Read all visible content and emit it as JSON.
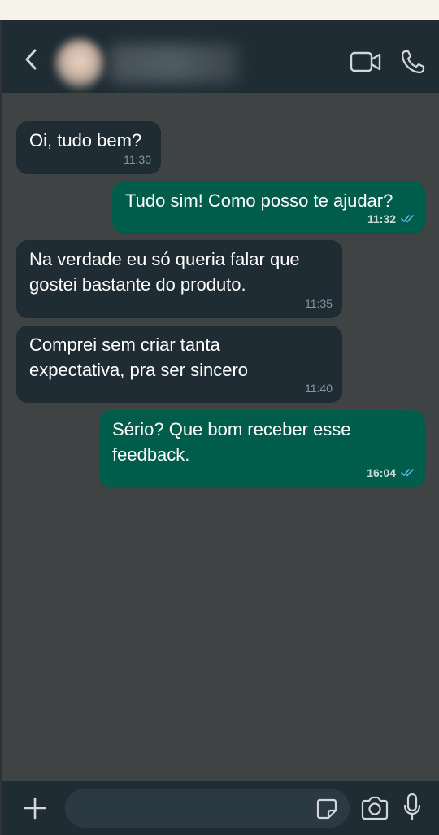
{
  "header": {
    "back_icon": "chevron-left-icon",
    "video_icon": "video-camera-icon",
    "call_icon": "phone-icon"
  },
  "messages": [
    {
      "direction": "in",
      "text": "Oi, tudo bem?",
      "time": "11:30"
    },
    {
      "direction": "out",
      "text": "Tudo sim! Como posso te ajudar?",
      "time": "11:32",
      "status": "read"
    },
    {
      "direction": "in",
      "text": "Na verdade eu só queria falar que\ngostei bastante do produto.",
      "time": "11:35"
    },
    {
      "direction": "in",
      "text": "Comprei sem criar tanta\nexpectativa, pra ser sincero",
      "time": "11:40"
    },
    {
      "direction": "out",
      "text": "Sério? Que bom receber esse\nfeedback.",
      "time": "16:04",
      "status": "read"
    }
  ],
  "input_bar": {
    "placeholder": "",
    "value": "",
    "icons": [
      "plus-icon",
      "sticker-icon",
      "camera-icon",
      "microphone-icon"
    ]
  },
  "colors": {
    "header_bg": "#1f2c33",
    "chat_bg": "#3f4344",
    "incoming_bubble": "#1f2c33",
    "outgoing_bubble": "#005c4b",
    "read_ticks": "#53bdeb"
  }
}
